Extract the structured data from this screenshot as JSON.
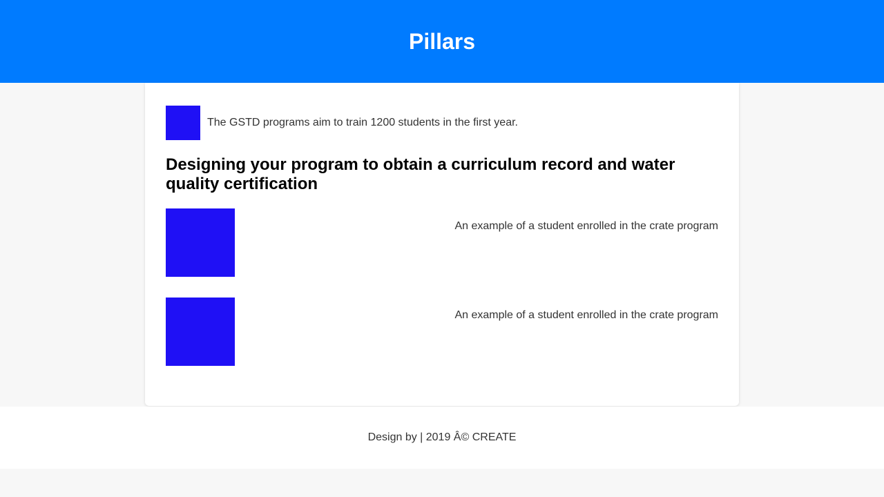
{
  "header": {
    "title": "Pillars",
    "background_color": "#007bff"
  },
  "main": {
    "intro": {
      "text": "The GSTD programs aim to train 1200 students in the first year.",
      "image_color": "#1f10f5"
    },
    "section_title": "Designing your program to obtain a curriculum record and water quality certification",
    "examples": [
      {
        "caption": "An example of a student enrolled in the crate program",
        "image_color": "#1f10f5"
      },
      {
        "caption": "An example of a student enrolled in the crate program",
        "image_color": "#1f10f5"
      }
    ]
  },
  "footer": {
    "text": "Design by | 2019 Â© CREATE"
  }
}
